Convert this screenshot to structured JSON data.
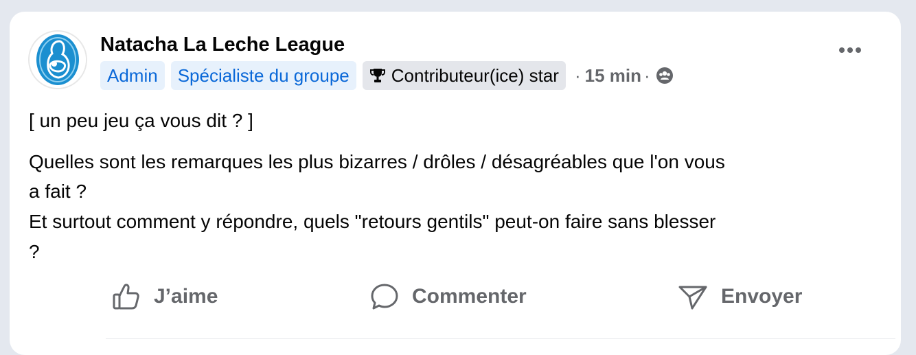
{
  "post": {
    "author_name": "Natacha La Leche League",
    "badges": {
      "admin": "Admin",
      "specialist": "Spécialiste du groupe",
      "star": "Contributeur(ice) star"
    },
    "separator": "·",
    "timestamp": "15 min",
    "audience_icon": "group-icon",
    "more_icon": "more-options-icon",
    "body": {
      "intro": "[ un peu jeu ça vous dit ? ]",
      "line1": "Quelles sont les remarques les plus bizarres / drôles / désagréables que l'on vous",
      "line2": "a fait ?",
      "line3": "Et surtout comment y répondre, quels \"retours gentils\" peut-on faire sans blesser",
      "line4": "?"
    }
  },
  "actions": {
    "like": "J’aime",
    "comment": "Commenter",
    "send": "Envoyer"
  },
  "colors": {
    "badge_blue_bg": "#e7f1fc",
    "badge_blue_text": "#0a68d8",
    "badge_gray_bg": "#e4e6eb",
    "secondary_text": "#65676b",
    "logo_blue": "#1b8fd0"
  }
}
